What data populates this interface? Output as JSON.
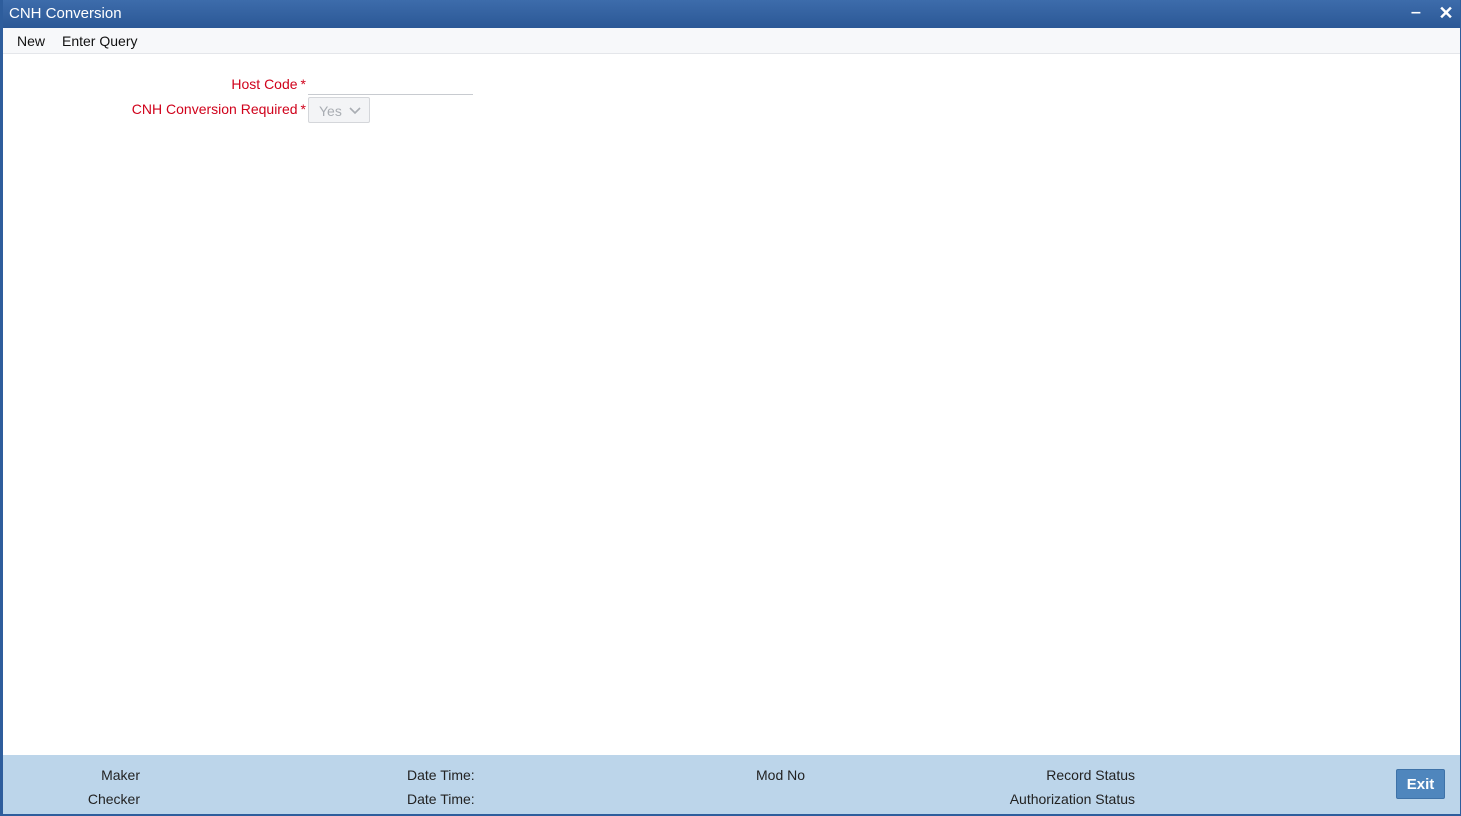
{
  "window": {
    "title": "CNH Conversion",
    "minimize_glyph": "‒",
    "close_glyph": "✕"
  },
  "menu": {
    "new_label": "New",
    "enter_query_label": "Enter Query"
  },
  "form": {
    "host_code": {
      "label": "Host Code",
      "required_mark": "*",
      "value": ""
    },
    "cnh_conversion_required": {
      "label": "CNH Conversion Required",
      "required_mark": "*",
      "selected": "Yes"
    }
  },
  "footer": {
    "maker_label": "Maker",
    "checker_label": "Checker",
    "maker_date_time_label": "Date Time:",
    "checker_date_time_label": "Date Time:",
    "mod_no_label": "Mod No",
    "record_status_label": "Record Status",
    "authorization_status_label": "Authorization Status",
    "exit_label": "Exit"
  },
  "colors": {
    "titlebar": "#2e5d9c",
    "required_label": "#d0021b",
    "footer_bg": "#bcd5ea",
    "exit_button": "#4f86bd"
  }
}
